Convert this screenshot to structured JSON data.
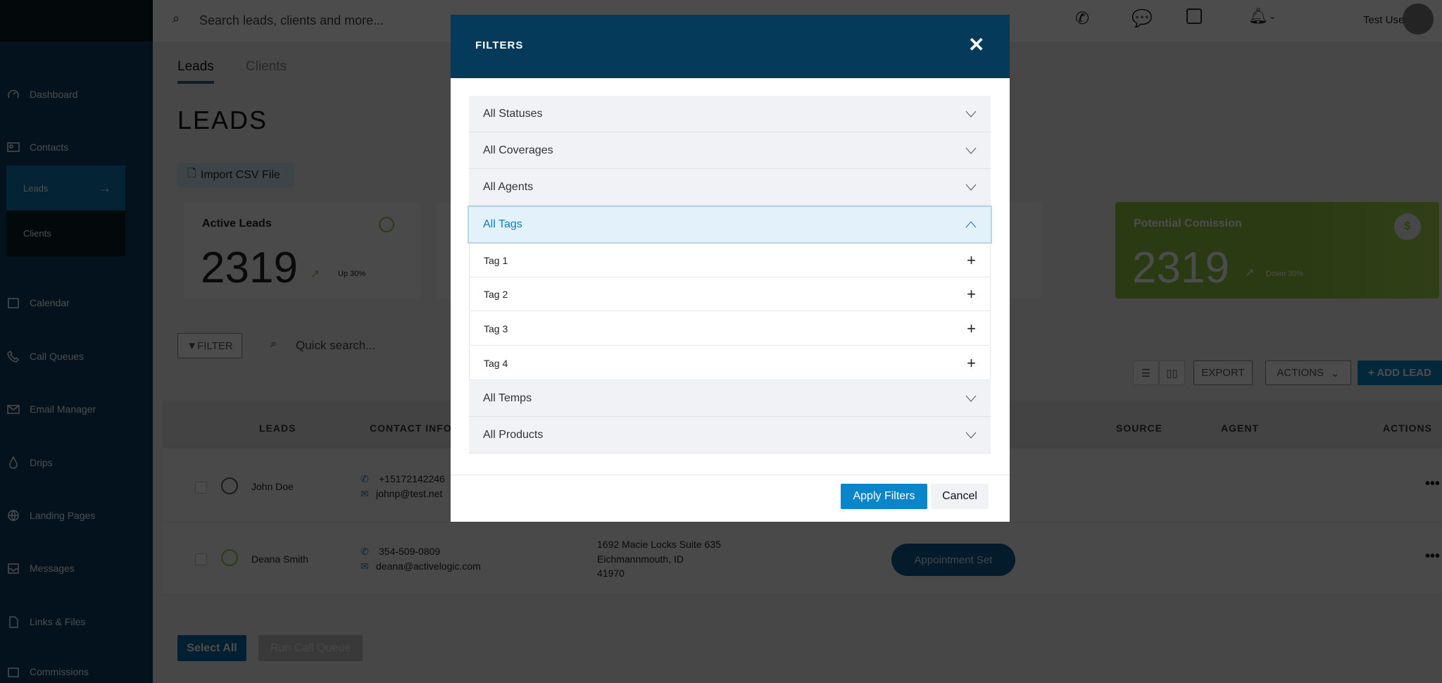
{
  "topbar": {
    "search_placeholder": "Search leads, clients and more...",
    "user_name": "Test User"
  },
  "sidebar": {
    "items": [
      {
        "label": "Dashboard",
        "icon": "dashboard-icon"
      },
      {
        "label": "Contacts",
        "icon": "contacts-icon"
      },
      {
        "label": "Calendar",
        "icon": "calendar-icon"
      },
      {
        "label": "Call Queues",
        "icon": "phone-icon"
      },
      {
        "label": "Email Manager",
        "icon": "email-icon"
      },
      {
        "label": "Drips",
        "icon": "drop-icon"
      },
      {
        "label": "Landing Pages",
        "icon": "globe-icon"
      },
      {
        "label": "Messages",
        "icon": "inbox-icon"
      },
      {
        "label": "Links & Files",
        "icon": "files-icon"
      },
      {
        "label": "Commissions",
        "icon": "wallet-icon"
      }
    ],
    "contacts_sub": [
      {
        "label": "Leads",
        "active": true
      },
      {
        "label": "Clients",
        "active": false
      }
    ]
  },
  "tabs": [
    {
      "label": "Leads",
      "active": true
    },
    {
      "label": "Clients",
      "active": false
    }
  ],
  "page_title": "LEADS",
  "import_label": "Import CSV File",
  "cards": {
    "active": {
      "title": "Active Leads",
      "value": "2319",
      "trend": "Up 30%"
    },
    "commission": {
      "title": "Potential Comission",
      "value": "2319",
      "trend": "Down 30%"
    }
  },
  "toolbar": {
    "filter_label": "FILTER",
    "quick_search_placeholder": "Quick search...",
    "export_label": "EXPORT",
    "actions_label": "ACTIONS",
    "add_lead_label": "+ ADD LEAD"
  },
  "table": {
    "headers": [
      "LEADS",
      "CONTACT INFO",
      "SOURCE",
      "AGENT",
      "ACTIONS"
    ],
    "rows": [
      {
        "name": "John Doe",
        "mood": "sad",
        "phone": "+15172142246",
        "email": "johnp@test.net"
      },
      {
        "name": "Deana Smith",
        "mood": "happy",
        "phone": "354-509-0809",
        "email": "deana@activelogic.com",
        "address": [
          "1692 Macie Locks Suite 635",
          "Eichmannmouth, ID",
          "41970"
        ],
        "status": "Appointment Set"
      }
    ]
  },
  "footer": {
    "select_all": "Select All",
    "run_call_queue": "Run Call Queue"
  },
  "modal": {
    "title": "FILTERS",
    "sections": [
      "All Statuses",
      "All Coverages",
      "All Agents",
      "All Tags",
      "All Temps",
      "All Products"
    ],
    "open_section": "All Tags",
    "tags": [
      "Tag 1",
      "Tag 2",
      "Tag 3",
      "Tag 4"
    ],
    "apply_label": "Apply Filters",
    "cancel_label": "Cancel"
  },
  "colors": {
    "primary": "#0a85c9",
    "modal_header": "#063a5a",
    "sidebar": "#0b3d5e",
    "commission_card": "#8dc63f"
  }
}
